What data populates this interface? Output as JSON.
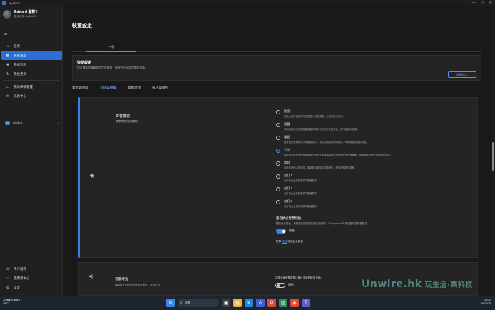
{
  "window": {
    "title": "MyASUS",
    "controls": [
      "—",
      "□",
      "✕"
    ]
  },
  "profile": {
    "name": "Edward 愛軒 !",
    "subtitle": "歡迎使用 MyASUS"
  },
  "sidebar": {
    "items": [
      {
        "label": "首頁",
        "icon": "home-icon",
        "glyph": "⌂"
      },
      {
        "label": "裝置設定",
        "icon": "grid-icon",
        "glyph": "▦",
        "active": true
      },
      {
        "label": "系統診斷",
        "icon": "diagnosis-icon",
        "glyph": "✚"
      },
      {
        "label": "系統更新",
        "icon": "update-icon",
        "glyph": "↻"
      },
      {
        "label": "我的華碩裝置",
        "icon": "devices-icon",
        "glyph": "▭"
      },
      {
        "label": "訊息中心",
        "icon": "message-icon",
        "glyph": "✉"
      },
      {
        "label": "GlideX",
        "icon": "glidex-icon",
        "glyph": "G"
      }
    ],
    "bottom": [
      {
        "label": "用戶服務",
        "icon": "support-icon",
        "glyph": "☏"
      },
      {
        "label": "使用者中心",
        "icon": "user-icon",
        "glyph": "☺"
      },
      {
        "label": "設定",
        "icon": "settings-icon",
        "glyph": "⚙"
      }
    ]
  },
  "main": {
    "title": "裝置設定",
    "top_tab": "一般",
    "quick": {
      "title": "快捷設定",
      "desc": "您可儲存您喜歡的設定成情景，輕鬆在不同設定間作切換。",
      "button": "快捷設定"
    },
    "subtabs": [
      "電池與效能",
      "音訊與視覺",
      "無線連接",
      "輸入與觸控"
    ],
    "audio": {
      "title": "聲音模式",
      "desc": "選擇理想的音頻模式",
      "modes": [
        {
          "label": "動感",
          "desc": "包括全景聲音調和內容並實行自動調整，以提供最佳效效。"
        },
        {
          "label": "遊戲",
          "desc": "清晰的聲音定位讓您能輕鬆辨別來自任何方向的聲音，提升遊戲玩家體。"
        },
        {
          "label": "電影",
          "desc": "從聲音空間和對白清晰度設定中，提供寬廣的音場環繞感，帶來極佳的觀影體驗。"
        },
        {
          "label": "音樂",
          "desc": "專為音樂播放的優質環繞感的音訊效果讓每顆音符有細節的聲音有機體，讓節奏感更感受到音樂的感情力。",
          "selected": true
        },
        {
          "label": "語音",
          "desc": "清晰透過的人聲品質，讓與新話播客和清聽變的，優化音檔表訊講餅。"
        },
        {
          "label": "自訂 1",
          "desc": "自訂包含全景聲音調平衡器模式"
        },
        {
          "label": "自訂 2",
          "desc": "自訂包含全景聲音調平衡器模式"
        },
        {
          "label": "自訂 3",
          "desc": "自訂包含全景聲音調平衡器模式"
        }
      ],
      "smart": {
        "title": "語音模式智慧切換",
        "desc": "開啟此功能後，系統將因您所觀影的影音資訊 - Dolby Atmos® 將自動切換語音模式。",
        "toggle_label": "開啟",
        "link_prefix": "點擊",
        "link_text": "這裡",
        "link_suffix": "設定此全景聲"
      }
    },
    "enhance": {
      "title": "音量增強",
      "desc": "讓裝置上的所有聲音都更響亮，且不失真。",
      "toggle_desc": "切換全景聲擴展是以最佳全景聲增強 功能。",
      "toggle_label": "關閉"
    }
  },
  "taskbar": {
    "weather_line1": "本地輸入環境尤",
    "weather_line2": "28°C",
    "search_placeholder": "搜尋",
    "time": "18:12",
    "date": "5/6/2025"
  },
  "watermark": {
    "text": "Unwire.hk",
    "cn": "玩生活·樂科技"
  }
}
